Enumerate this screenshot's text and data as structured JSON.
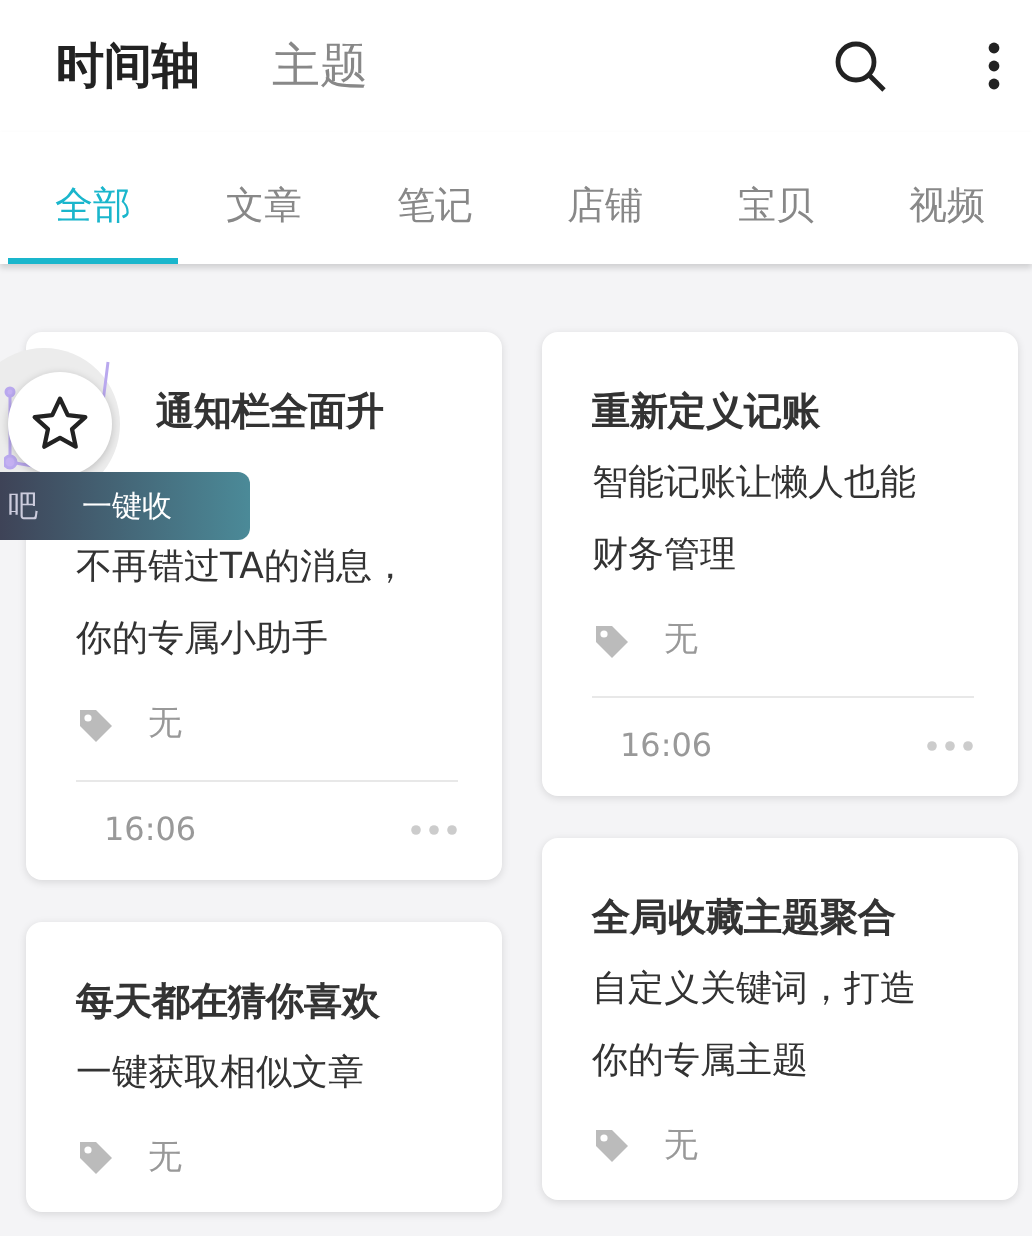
{
  "header": {
    "tabs": [
      {
        "label": "时间轴",
        "selected": true
      },
      {
        "label": "主题",
        "selected": false
      }
    ]
  },
  "categories": [
    {
      "label": "全部",
      "selected": true
    },
    {
      "label": "文章",
      "selected": false
    },
    {
      "label": "笔记",
      "selected": false
    },
    {
      "label": "店铺",
      "selected": false
    },
    {
      "label": "宝贝",
      "selected": false
    },
    {
      "label": "视频",
      "selected": false
    }
  ],
  "columns": [
    {
      "cards": [
        {
          "title": "通知栏全面升",
          "description": "不再错过TA的消息，你的专属小助手",
          "tag": "无",
          "time": "16:06"
        },
        {
          "title": "每天都在猜你喜欢",
          "description": "一键获取相似文章",
          "tag": "无"
        }
      ]
    },
    {
      "cards": [
        {
          "title": "重新定义记账",
          "description": "智能记账让懒人也能财务管理",
          "tag": "无",
          "time": "16:06"
        },
        {
          "title": "全局收藏主题聚合",
          "description": "自定义关键词，打造你的专属主题",
          "tag": "无"
        }
      ]
    }
  ],
  "floating_widget": {
    "banner": [
      "吧",
      "一键收"
    ]
  }
}
